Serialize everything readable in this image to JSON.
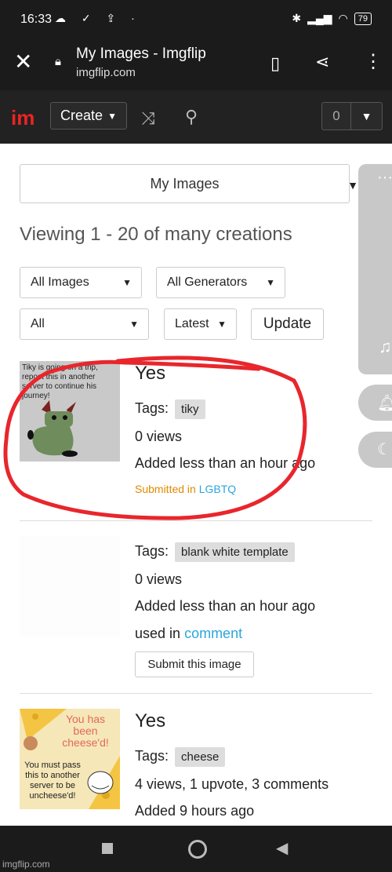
{
  "status": {
    "time": "16:33",
    "battery": "79"
  },
  "browser": {
    "page_title": "My Images - Imgflip",
    "host": "imgflip.com"
  },
  "nav": {
    "logo": "im",
    "create": "Create",
    "notif_count": "0"
  },
  "main": {
    "dropdown": "My Images",
    "viewing": "Viewing 1 - 20 of many creations",
    "filters": [
      "All Images",
      "All Generators",
      "All",
      "Latest"
    ],
    "update": "Update"
  },
  "items": [
    {
      "title": "Yes",
      "tags_label": "Tags:",
      "tag": "tiky",
      "views": "0 views",
      "added": "Added less than an hour ago",
      "submitted_prefix": "Submitted in",
      "submitted_link": "LGBTQ",
      "thumb_text": "Tiky is going on a trip, repost this in another server to continue his journey!"
    },
    {
      "tags_label": "Tags:",
      "tag": "blank white template",
      "views": "0 views",
      "added": "Added less than an hour ago",
      "used_prefix": "used in",
      "used_link": "comment",
      "submit_btn": "Submit this image"
    },
    {
      "title": "Yes",
      "tags_label": "Tags:",
      "tag": "cheese",
      "views": "4 views, 1 upvote, 3 comments",
      "added": "Added 9 hours ago",
      "thumb_text_top": "You has been cheese'd!",
      "thumb_text_bottom": "You must pass this to another server to be uncheese'd!"
    }
  ],
  "watermark": "imgflip.com",
  "colors": {
    "accent_link": "#2aa7dd",
    "submitted": "#e08a00",
    "logo": "#e22222",
    "annotation": "#e8262c"
  }
}
